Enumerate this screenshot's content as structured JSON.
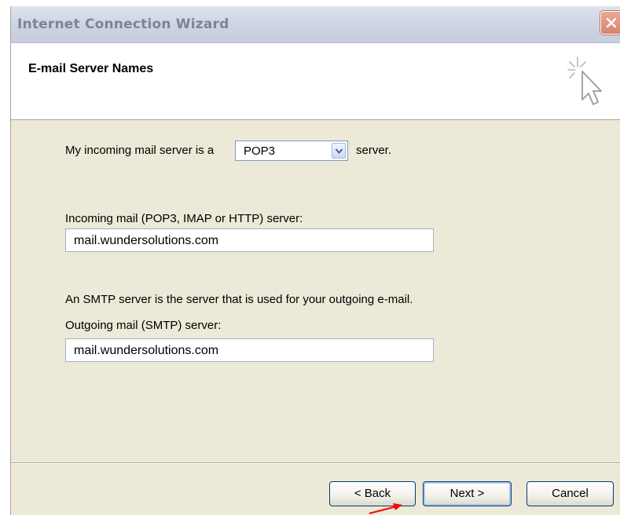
{
  "window": {
    "title": "Internet Connection Wizard"
  },
  "header": {
    "title": "E-mail Server Names"
  },
  "incoming_type": {
    "prefix": "My incoming mail server is a",
    "selected": "POP3",
    "suffix": "server."
  },
  "incoming": {
    "label": "Incoming mail (POP3, IMAP or HTTP) server:",
    "value": "mail.wundersolutions.com"
  },
  "smtp_note": "An SMTP server is the server that is used for your outgoing e-mail.",
  "outgoing": {
    "label": "Outgoing mail (SMTP) server:",
    "value": "mail.wundersolutions.com"
  },
  "buttons": {
    "back": "< Back",
    "next": "Next >",
    "cancel": "Cancel"
  },
  "annotation": {
    "arrow_color": "#ff0000"
  }
}
